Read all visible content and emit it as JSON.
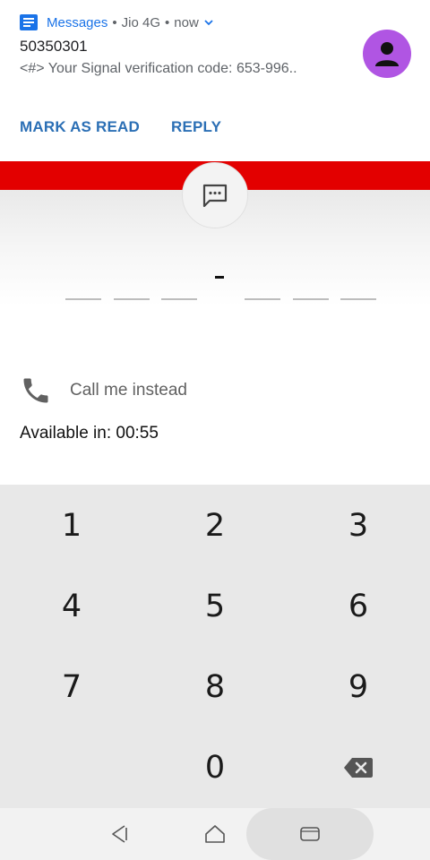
{
  "notification": {
    "app_name": "Messages",
    "separator": "•",
    "carrier": "Jio 4G",
    "time": "now",
    "sender": "50350301",
    "preview": "<#> Your Signal verification code: 653-996..",
    "actions": {
      "mark_as_read": "MARK AS READ",
      "reply": "REPLY"
    },
    "accent_color": "#1a73e8",
    "avatar_color": "#b055e3"
  },
  "verification": {
    "brand_color": "#e30000",
    "icon": "message-dots-icon",
    "code_separator": "-",
    "digit_slots": [
      "",
      "",
      "",
      "",
      "",
      ""
    ]
  },
  "call_option": {
    "label": "Call me instead",
    "icon": "phone-icon",
    "available_text": "Available in: 00:55"
  },
  "keypad": {
    "keys": [
      "1",
      "2",
      "3",
      "4",
      "5",
      "6",
      "7",
      "8",
      "9",
      "0"
    ],
    "backspace_icon": "backspace-icon"
  },
  "navbar": {
    "back_icon": "back-triangle-icon",
    "home_icon": "home-icon",
    "recents_icon": "recents-icon"
  }
}
